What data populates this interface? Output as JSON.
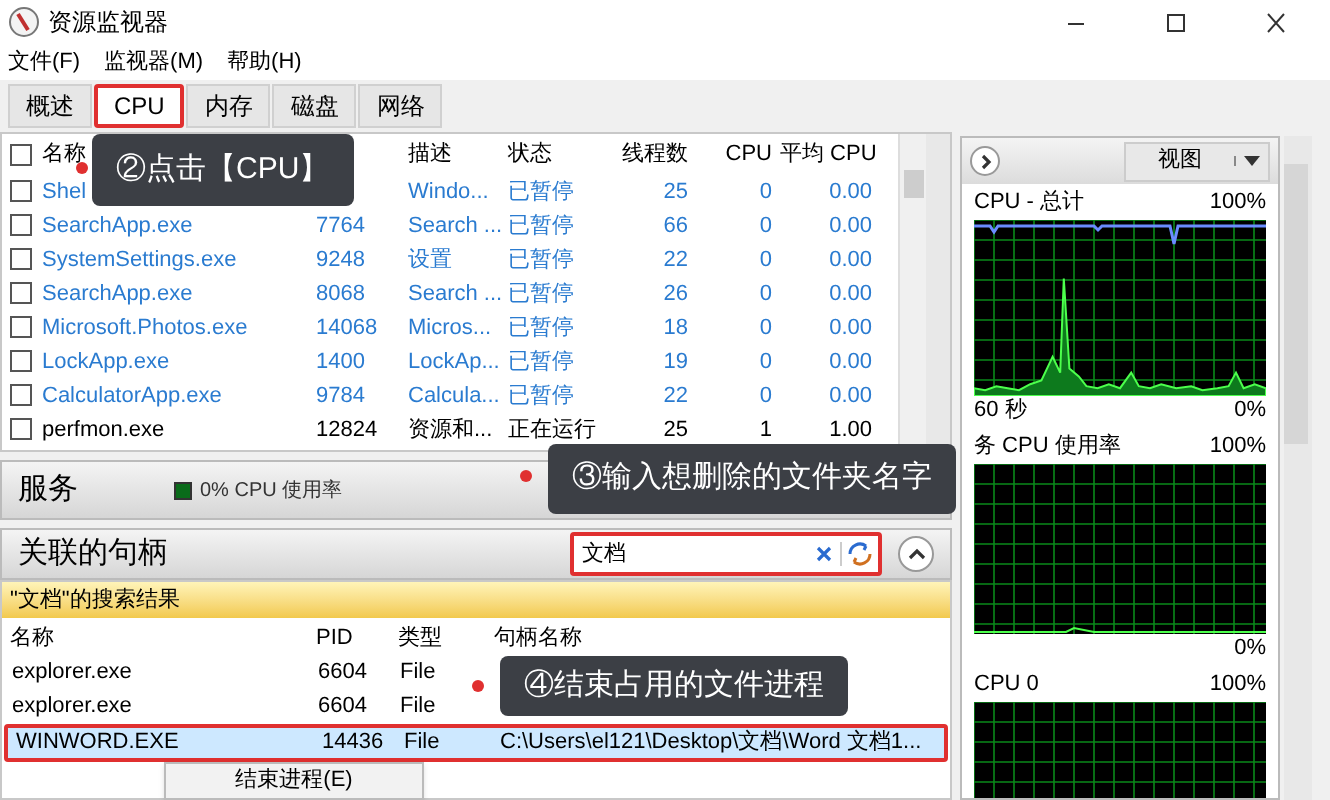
{
  "window": {
    "title": "资源监视器"
  },
  "menu": [
    "文件(F)",
    "监视器(M)",
    "帮助(H)"
  ],
  "tabs": [
    {
      "label": "概述",
      "selected": false,
      "highlighted": false
    },
    {
      "label": "CPU",
      "selected": true,
      "highlighted": true
    },
    {
      "label": "内存",
      "selected": false,
      "highlighted": false
    },
    {
      "label": "磁盘",
      "selected": false,
      "highlighted": false
    },
    {
      "label": "网络",
      "selected": false,
      "highlighted": false
    }
  ],
  "processes": {
    "all_checked": false,
    "columns": [
      "名称",
      "描述",
      "状态",
      "线程数",
      "CPU",
      "平均 CPU"
    ],
    "rows": [
      {
        "checked": false,
        "suspended": true,
        "name": "Shel",
        "description": "Windo...",
        "status": "已暂停",
        "threads": "25",
        "cpu": "0",
        "avg_cpu": "0.00"
      },
      {
        "checked": false,
        "suspended": true,
        "name": "SearchApp.exe",
        "pid": "7764",
        "description": "Search ...",
        "status": "已暂停",
        "threads": "66",
        "cpu": "0",
        "avg_cpu": "0.00"
      },
      {
        "checked": false,
        "suspended": true,
        "name": "SystemSettings.exe",
        "pid": "9248",
        "description": "设置",
        "status": "已暂停",
        "threads": "22",
        "cpu": "0",
        "avg_cpu": "0.00"
      },
      {
        "checked": false,
        "suspended": true,
        "name": "SearchApp.exe",
        "pid": "8068",
        "description": "Search ...",
        "status": "已暂停",
        "threads": "26",
        "cpu": "0",
        "avg_cpu": "0.00"
      },
      {
        "checked": false,
        "suspended": true,
        "name": "Microsoft.Photos.exe",
        "pid": "14068",
        "description": "Micros...",
        "status": "已暂停",
        "threads": "18",
        "cpu": "0",
        "avg_cpu": "0.00"
      },
      {
        "checked": false,
        "suspended": true,
        "name": "LockApp.exe",
        "pid": "1400",
        "description": "LockAp...",
        "status": "已暂停",
        "threads": "19",
        "cpu": "0",
        "avg_cpu": "0.00"
      },
      {
        "checked": false,
        "suspended": true,
        "name": "CalculatorApp.exe",
        "pid": "9784",
        "description": "Calcula...",
        "status": "已暂停",
        "threads": "22",
        "cpu": "0",
        "avg_cpu": "0.00"
      },
      {
        "checked": false,
        "suspended": false,
        "name": "perfmon.exe",
        "pid": "12824",
        "description": "资源和...",
        "status": "正在运行",
        "threads": "25",
        "cpu": "1",
        "avg_cpu": "1.00"
      }
    ]
  },
  "services": {
    "title": "服务",
    "summary": "0% CPU 使用率"
  },
  "handles": {
    "title": "关联的句柄",
    "search": {
      "value": "文档",
      "highlighted": true
    },
    "results_caption": "\"文档\"的搜索结果",
    "columns": [
      "名称",
      "PID",
      "类型",
      "句柄名称"
    ],
    "rows": [
      {
        "name": "explorer.exe",
        "pid": "6604",
        "type": "File",
        "selected": false,
        "highlighted": false
      },
      {
        "name": "explorer.exe",
        "pid": "6604",
        "type": "File",
        "selected": false,
        "highlighted": false
      },
      {
        "name": "WINWORD.EXE",
        "pid": "14436",
        "type": "File",
        "handle": "C:\\Users\\el121\\Desktop\\文档\\Word 文档1...",
        "selected": true,
        "highlighted": true
      }
    ]
  },
  "context_menu": {
    "items": [
      "结束进程(E)"
    ]
  },
  "callouts": [
    "②点击【CPU】",
    "③输入想删除的文件夹名字",
    "④结束占用的文件进程"
  ],
  "monitor": {
    "view_button": "视图",
    "graphs": [
      {
        "title": "CPU - 总计",
        "max": "100%",
        "time": "60 秒",
        "min": "0%"
      },
      {
        "title": "务 CPU 使用率",
        "max": "100%",
        "min": "0%"
      },
      {
        "title": "CPU 0",
        "max": "100%"
      }
    ]
  }
}
